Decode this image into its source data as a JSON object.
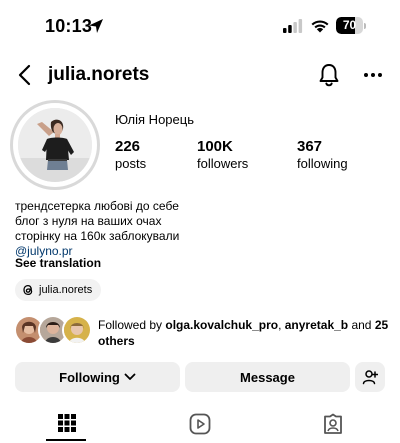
{
  "status_bar": {
    "time": "10:13",
    "battery": "70",
    "battery_level": 0.7
  },
  "header": {
    "username": "julia.norets"
  },
  "profile": {
    "full_name": "Юлія Норець",
    "stats": [
      {
        "value": "226",
        "label": "posts"
      },
      {
        "value": "100K",
        "label": "followers"
      },
      {
        "value": "367",
        "label": "following"
      }
    ],
    "bio_lines": [
      "трендсетерка любові до себе",
      "блог з нуля на ваших очах",
      "сторінку на 160к заблокували"
    ],
    "bio_link": "@julyno.pr",
    "see_translation": "See translation",
    "threads_handle": "julia.norets"
  },
  "followed_by": {
    "prefix": "Followed by ",
    "user1": "olga.kovalchuk_pro",
    "separator": ", ",
    "user2": "anyretak_b",
    "and": " and ",
    "others": "25 others"
  },
  "actions": {
    "following_label": "Following",
    "message_label": "Message"
  },
  "tabs": [
    {
      "icon": "grid-icon",
      "active": true
    },
    {
      "icon": "reels-icon",
      "active": false
    },
    {
      "icon": "tagged-icon",
      "active": false
    }
  ]
}
